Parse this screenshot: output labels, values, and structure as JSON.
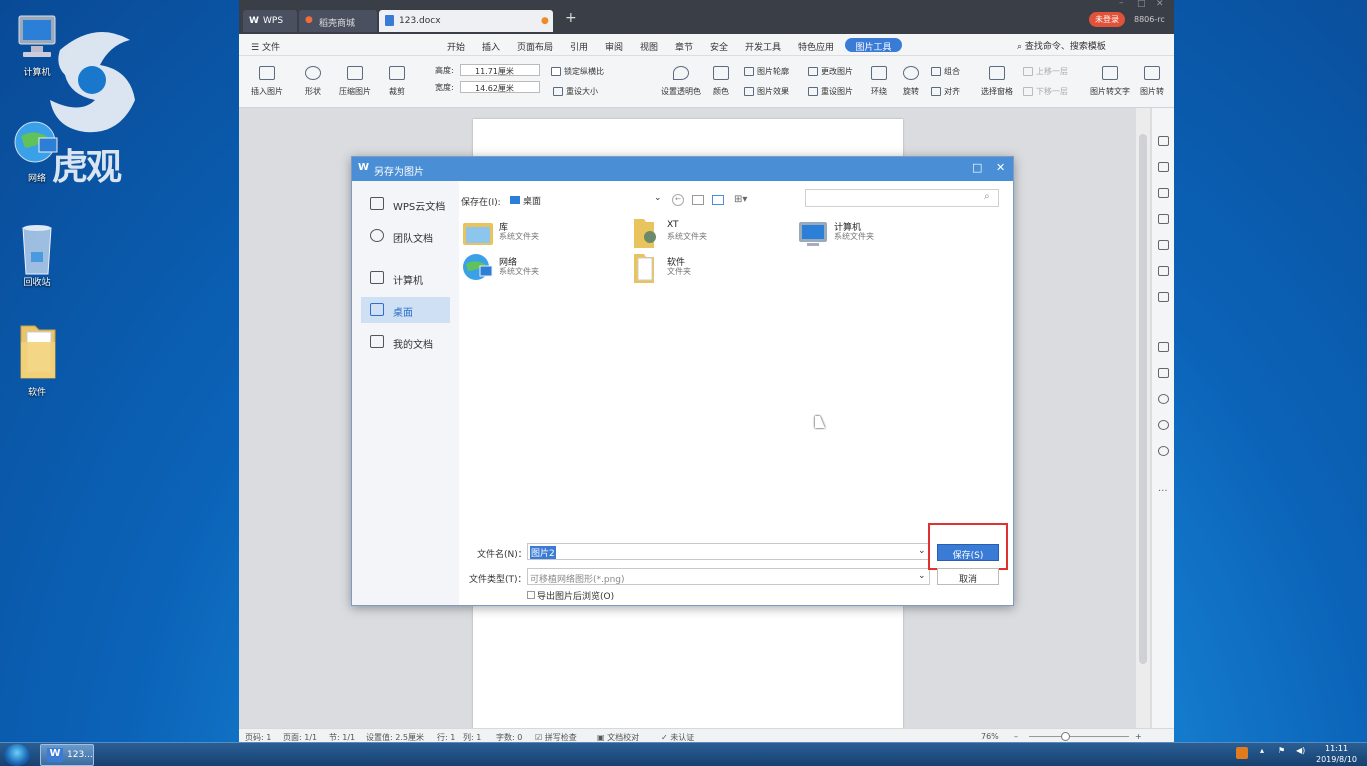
{
  "desktop": {
    "icons": [
      {
        "label": "计算机"
      },
      {
        "label": "网络"
      },
      {
        "label": "回收站"
      },
      {
        "label": "软件"
      }
    ],
    "watermark": "虎观"
  },
  "taskbar": {
    "app_label": "123...",
    "time": "11:11",
    "date": "2019/8/10"
  },
  "wps": {
    "tabs": [
      "WPS",
      "稻壳商城",
      "123.docx"
    ],
    "user_badge": "未登录",
    "user_id": "8806-rc",
    "menu": [
      "文件",
      "开始",
      "插入",
      "页面布局",
      "引用",
      "审阅",
      "视图",
      "章节",
      "安全",
      "开发工具",
      "特色应用"
    ],
    "active_menu": "图片工具",
    "search_hint": "查找命令、搜索模板",
    "ribbon": {
      "insert_image": "插入图片",
      "shape": "形状",
      "compress": "压缩图片",
      "crop": "裁剪",
      "height_label": "高度:",
      "height_value": "11.71厘米",
      "width_label": "宽度:",
      "width_value": "14.62厘米",
      "lock_ratio": "锁定纵横比",
      "reset_size": "重设大小",
      "transparent": "设置透明色",
      "color": "颜色",
      "outline": "图片轮廓",
      "effect": "图片效果",
      "change_image": "更改图片",
      "reset_image": "重设图片",
      "wrap": "环绕",
      "rotate": "旋转",
      "group": "组合",
      "align": "对齐",
      "selection_pane": "选择窗格",
      "bring_forward": "上移一层",
      "send_backward": "下移一层",
      "to_text": "图片转文字",
      "to_more": "图片转"
    },
    "status": {
      "page_no": "页码: 1",
      "pages": "页面: 1/1",
      "section": "节: 1/1",
      "setting": "设置值: 2.5厘米",
      "row": "行: 1",
      "col": "列: 1",
      "words": "字数: 0",
      "spell": "拼写检查",
      "proof": "文档校对",
      "cert": "未认证",
      "zoom": "76%"
    }
  },
  "dialog": {
    "title": "另存为图片",
    "sidebar": [
      "WPS云文档",
      "团队文档",
      "计算机",
      "桌面",
      "我的文档"
    ],
    "save_in_label": "保存在(I):",
    "save_in_value": "桌面",
    "files": [
      {
        "name": "库",
        "desc": "系统文件夹"
      },
      {
        "name": "XT",
        "desc": "系统文件夹"
      },
      {
        "name": "计算机",
        "desc": "系统文件夹"
      },
      {
        "name": "网络",
        "desc": "系统文件夹"
      },
      {
        "name": "软件",
        "desc": "文件夹"
      }
    ],
    "filename_label": "文件名(N)：",
    "filename_value": "图片2",
    "filetype_label": "文件类型(T)：",
    "filetype_value": "可移植网络图形(*.png)",
    "browse_after": "导出图片后浏览(O)",
    "save_button": "保存(S)",
    "cancel_button": "取消",
    "highlight_color": "#e03030",
    "accent_color": "#4a8fd6"
  }
}
